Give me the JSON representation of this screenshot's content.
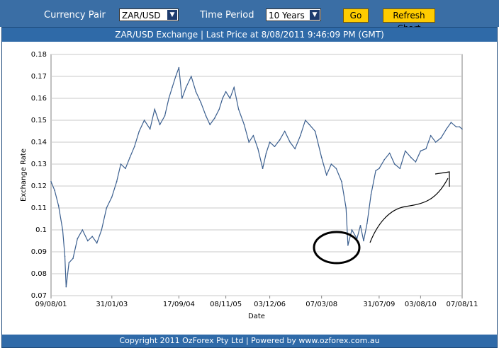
{
  "toolbar": {
    "currency_pair_label": "Currency Pair",
    "currency_pair_value": "ZAR/USD",
    "time_period_label": "Time Period",
    "time_period_value": "10 Years",
    "go_label": "Go",
    "refresh_label": "Refresh Chart"
  },
  "chart_title": "ZAR/USD Exchange |  Last Price at 8/08/2011 9:46:09 PM (GMT)",
  "footer": "Copyright 2011 OzForex Pty Ltd | Powered by www.ozforex.com.au",
  "colors": {
    "bar": "#3a6ea5",
    "line": "#3b5f8f",
    "button": "#ffcc00"
  },
  "chart_data": {
    "type": "line",
    "title": "ZAR/USD Exchange |  Last Price at 8/08/2011 9:46:09 PM (GMT)",
    "xlabel": "Date",
    "ylabel": "Exchange Rate",
    "ylim": [
      0.07,
      0.18
    ],
    "yticks": [
      "0.07",
      "0.08",
      "0.09",
      "0.1",
      "0.11",
      "0.12",
      "0.13",
      "0.14",
      "0.15",
      "0.16",
      "0.17",
      "0.18"
    ],
    "xticks": [
      "09/08/01",
      "31/01/03",
      "17/09/04",
      "08/11/05",
      "03/12/06",
      "07/03/08",
      "31/07/09",
      "03/08/10",
      "07/08/11"
    ],
    "grid": true,
    "series": [
      {
        "x": [
          "2001-08-09",
          "2001-09-10",
          "2001-10-15",
          "2001-11-20",
          "2001-12-10",
          "2001-12-21",
          "2002-01-15",
          "2002-02-20",
          "2002-04-01",
          "2002-05-15",
          "2002-07-01",
          "2002-08-10",
          "2002-09-20",
          "2002-11-01",
          "2002-12-15",
          "2003-01-31",
          "2003-03-15",
          "2003-04-20",
          "2003-06-01",
          "2003-07-10",
          "2003-08-20",
          "2003-10-01",
          "2003-11-15",
          "2004-01-05",
          "2004-02-15",
          "2004-04-01",
          "2004-05-15",
          "2004-06-20",
          "2004-07-20",
          "2004-08-20",
          "2004-09-17",
          "2004-10-15",
          "2004-11-20",
          "2005-01-05",
          "2005-02-15",
          "2005-04-01",
          "2005-05-15",
          "2005-06-20",
          "2005-08-01",
          "2005-09-10",
          "2005-10-10",
          "2005-11-08",
          "2005-12-15",
          "2006-01-20",
          "2006-03-01",
          "2006-04-20",
          "2006-06-01",
          "2006-07-10",
          "2006-08-20",
          "2006-10-01",
          "2006-11-01",
          "2006-12-03",
          "2007-01-15",
          "2007-03-01",
          "2007-04-15",
          "2007-06-01",
          "2007-07-15",
          "2007-09-01",
          "2007-10-15",
          "2007-11-20",
          "2008-01-10",
          "2008-03-07",
          "2008-04-20",
          "2008-06-01",
          "2008-07-15",
          "2008-09-01",
          "2008-10-10",
          "2008-10-27",
          "2008-12-01",
          "2009-01-15",
          "2009-02-15",
          "2009-03-15",
          "2009-04-15",
          "2009-05-20",
          "2009-07-01",
          "2009-07-31",
          "2009-09-15",
          "2009-11-01",
          "2009-12-15",
          "2010-02-01",
          "2010-03-20",
          "2010-05-10",
          "2010-06-20",
          "2010-08-03",
          "2010-09-20",
          "2010-11-01",
          "2010-12-15",
          "2011-02-01",
          "2011-03-20",
          "2011-05-01",
          "2011-06-15",
          "2011-07-15",
          "2011-08-07"
        ],
        "y": [
          0.122,
          0.118,
          0.111,
          0.1,
          0.088,
          0.074,
          0.085,
          0.087,
          0.096,
          0.1,
          0.095,
          0.097,
          0.094,
          0.1,
          0.11,
          0.115,
          0.122,
          0.13,
          0.128,
          0.133,
          0.138,
          0.145,
          0.15,
          0.146,
          0.155,
          0.148,
          0.152,
          0.16,
          0.165,
          0.17,
          0.174,
          0.16,
          0.165,
          0.17,
          0.163,
          0.158,
          0.152,
          0.148,
          0.151,
          0.155,
          0.16,
          0.163,
          0.16,
          0.165,
          0.155,
          0.148,
          0.14,
          0.143,
          0.137,
          0.128,
          0.135,
          0.14,
          0.138,
          0.141,
          0.145,
          0.14,
          0.137,
          0.143,
          0.15,
          0.148,
          0.145,
          0.133,
          0.125,
          0.13,
          0.128,
          0.122,
          0.11,
          0.093,
          0.1,
          0.096,
          0.102,
          0.095,
          0.103,
          0.116,
          0.127,
          0.128,
          0.132,
          0.135,
          0.13,
          0.128,
          0.136,
          0.133,
          0.131,
          0.136,
          0.137,
          0.143,
          0.14,
          0.142,
          0.146,
          0.149,
          0.147,
          0.147,
          0.146
        ]
      }
    ]
  },
  "annotations": {
    "circle": "hand-drawn-circle",
    "arrow": "hand-drawn-arrow"
  }
}
